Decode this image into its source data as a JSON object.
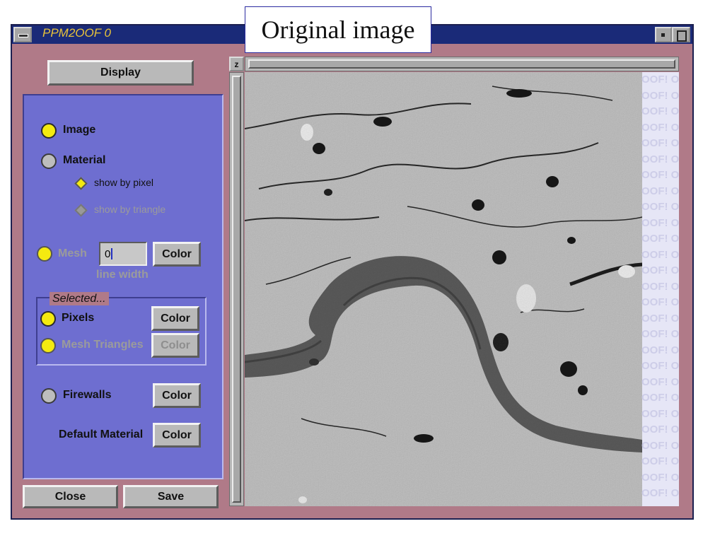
{
  "caption": "Original image",
  "window": {
    "title": "PPM2OOF 0"
  },
  "display_button": "Display",
  "options": {
    "image_label": "Image",
    "material_label": "Material",
    "show_by_pixel": "show by pixel",
    "show_by_triangle": "show by triangle",
    "mesh_label": "Mesh",
    "mesh_line_width_value": "0",
    "line_width_label": "line width",
    "color_label": "Color",
    "selected_label": "Selected...",
    "pixels_label": "Pixels",
    "mesh_triangles_label": "Mesh Triangles",
    "firewalls_label": "Firewalls",
    "default_material_label": "Default Material"
  },
  "footer": {
    "close": "Close",
    "save": "Save"
  },
  "viewer": {
    "zoom_button": "z",
    "watermark_text": "OOF! O"
  },
  "colors": {
    "window_frame": "#b07a88",
    "title_bar": "#1a2a78",
    "title_text": "#e8c23a",
    "panel": "#6e6ed0",
    "radio_on": "#f4ea10",
    "button": "#b9b9b9"
  }
}
